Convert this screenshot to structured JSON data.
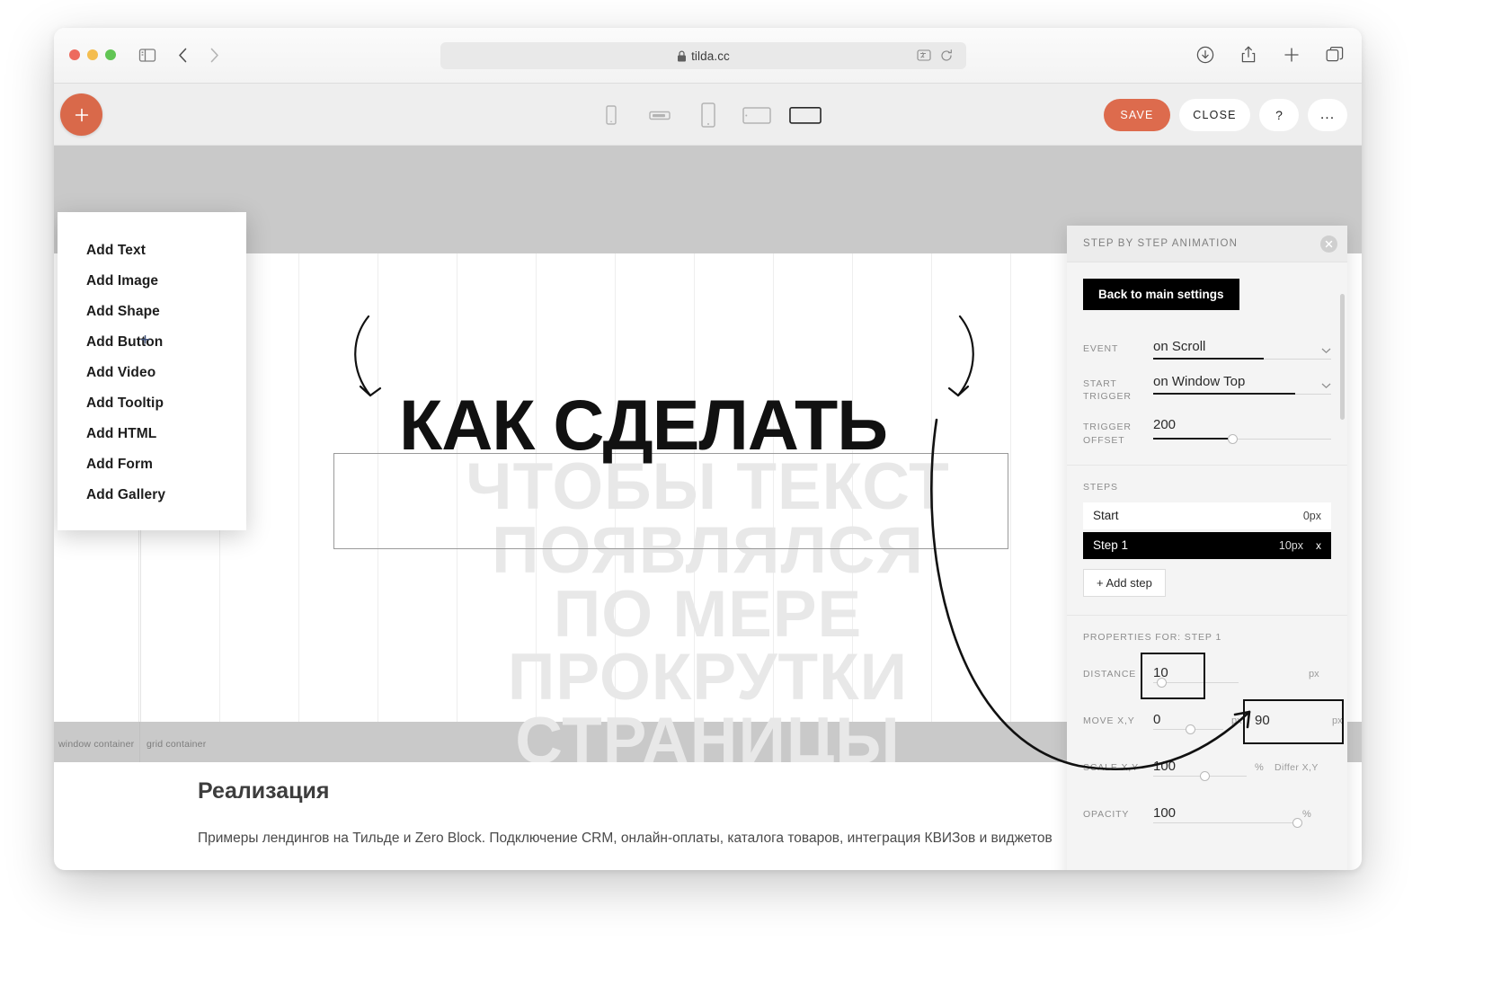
{
  "browser": {
    "url": "tilda.cc",
    "lock_icon": "lock-icon",
    "sidebar_icon": "sidebar-toggle-icon",
    "back_icon": "chevron-left-icon",
    "forward_icon": "chevron-right-icon",
    "translate_icon": "translate-icon",
    "reload_icon": "reload-icon",
    "download_icon": "download-icon",
    "share_icon": "share-icon",
    "new_tab_icon": "plus-icon",
    "tabs_icon": "tab-overview-icon"
  },
  "editor": {
    "add_block_icon": "plus-icon",
    "devices": [
      {
        "name": "phone-portrait",
        "active": false
      },
      {
        "name": "phone-landscape",
        "active": false
      },
      {
        "name": "tablet-portrait",
        "active": false
      },
      {
        "name": "tablet-landscape",
        "active": false
      },
      {
        "name": "desktop",
        "active": true
      }
    ],
    "actions": {
      "save_label": "SAVE",
      "close_label": "CLOSE",
      "help_label": "?",
      "more_label": "..."
    },
    "accent_color": "#d9694a"
  },
  "add_menu": {
    "items": [
      {
        "label": "Add Text"
      },
      {
        "label": "Add Image"
      },
      {
        "label": "Add Shape"
      },
      {
        "label": "Add Button"
      },
      {
        "label": "Add Video"
      },
      {
        "label": "Add Tooltip"
      },
      {
        "label": "Add HTML"
      },
      {
        "label": "Add Form"
      },
      {
        "label": "Add Gallery"
      }
    ],
    "cursor_glyph": "+"
  },
  "canvas": {
    "headline": "КАК СДЕЛАТЬ",
    "ghost_lines": [
      "ЧТОБЫ ТЕКСТ",
      "ПОЯВЛЯЛСЯ",
      "ПО МЕРЕ",
      "ПРОКРУТКИ",
      "СТРАНИЦЫ"
    ],
    "grid_labels": {
      "window_container": "window container",
      "grid_container": "grid container"
    }
  },
  "page_section": {
    "title": "Реализация",
    "description": "Примеры лендингов на Тильде и Zero Block. Подключение CRM, онлайн-оплаты, каталога товаров, интеграция КВИЗов и виджетов",
    "fab_icon": "plus-icon"
  },
  "panel": {
    "title": "STEP BY STEP ANIMATION",
    "close_icon": "close-icon",
    "back_button": "Back to main settings",
    "fields": [
      {
        "label": "EVENT",
        "value": "on Scroll",
        "type": "select"
      },
      {
        "label": "START TRIGGER",
        "label_line1": "START",
        "label_line2": "TRIGGER",
        "value": "on Window Top",
        "type": "select"
      },
      {
        "label": "TRIGGER OFFSET",
        "label_line1": "TRIGGER",
        "label_line2": "OFFSET",
        "value": "200",
        "type": "slider"
      }
    ],
    "steps_label": "STEPS",
    "steps": [
      {
        "name": "Start",
        "size": "0px",
        "active": false,
        "removable": false
      },
      {
        "name": "Step 1",
        "size": "10px",
        "active": true,
        "removable": true,
        "remove_label": "x"
      }
    ],
    "add_step_label": "+ Add step",
    "properties_label": "PROPERTIES FOR: STEP 1",
    "properties": [
      {
        "label": "DISTANCE",
        "value": "10",
        "unit": "px",
        "highlighted": true,
        "knob_pct": 8
      },
      {
        "label": "MOVE X,Y",
        "value": "0",
        "unit": "px",
        "value2": "90",
        "unit2": "px",
        "highlighted2": true,
        "knob_pct": 50
      },
      {
        "label": "SCALE X,Y",
        "value": "100",
        "unit": "%",
        "extra": "Differ X,Y",
        "knob_pct": 50
      },
      {
        "label": "OPACITY",
        "value": "100",
        "unit": "%",
        "knob_pct": 100
      }
    ]
  }
}
